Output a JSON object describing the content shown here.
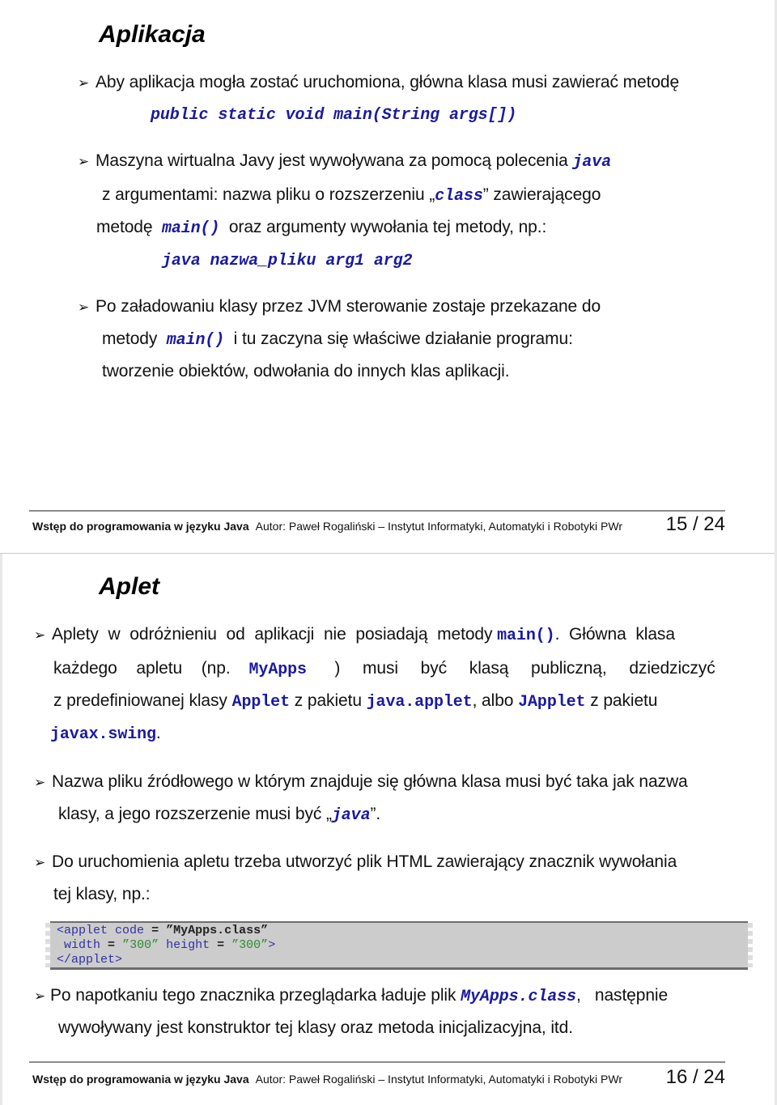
{
  "slides": [
    {
      "title": "Aplikacja",
      "bullets": [
        {
          "lines": [
            {
              "text": "Aby aplikacja mogła zostać uruchomiona, główna klasa musi zawierać metodę"
            },
            {
              "code": "public static void main(String args[])"
            }
          ]
        },
        {
          "line1_text": "Maszyna wirtualna Javy jest wywoływana za pomocą polecenia",
          "line1_code": "java",
          "line2_pre": "z argumentami: nazwa pliku o rozszerzeniu „",
          "line2_code": "class",
          "line2_post": "” zawierającego",
          "line3_pre": "metodę",
          "line3_code": "main()",
          "line3_post": "oraz argumenty wywołania tej metody, np.:",
          "example_code": "java nazwa_pliku arg1 arg2"
        },
        {
          "line1": "Po załadowaniu klasy przez JVM sterowanie zostaje przekazane do",
          "line2_pre": "metody",
          "line2_code": "main()",
          "line2_post": "i tu zaczyna się właściwe działanie programu:",
          "line3": "tworzenie obiektów, odwołania do innych klas aplikacji."
        }
      ],
      "footer": {
        "course": "Wstęp do programowania w języku Java",
        "author": "Autor: Paweł Rogaliński – Instytut Informatyki, Automatyki i Robotyki PWr",
        "page": "15 / 24"
      }
    },
    {
      "title": "Aplet",
      "bullets": [
        {
          "l1_pre": "Aplety w odróżnieniu od aplikacji nie posiadają metody",
          "l1_code": "main()",
          "l1_post": ". Główna klasa",
          "l2_pre": "każdego apletu (np.",
          "l2_code": "MyApps",
          "l2_post": ") musi być klasą publiczną, dziedziczyć",
          "l3_a": "z predefiniowanej klasy",
          "l3_code1": "Applet",
          "l3_b": "z pakietu",
          "l3_code2": "java.applet",
          "l3_c": ", albo",
          "l3_code3": "JApplet",
          "l3_d": "z pakietu",
          "l4_code": "javax.swing",
          "l4_post": "."
        },
        {
          "line1": "Nazwa pliku źródłowego w którym znajduje się główna klasa musi być taka jak nazwa",
          "line2_pre": "klasy, a jego rozszerzenie musi być „",
          "line2_code": "java",
          "line2_post": "”."
        },
        {
          "line1": "Do uruchomienia apletu trzeba utworzyć plik HTML zawierający znacznik wywołania",
          "line2": "tej klasy, np.:"
        },
        {
          "line1_pre": "Po napotkaniu tego znacznika przeglądarka ładuje plik",
          "line1_code": "MyApps.class",
          "line1_post": ",   następnie",
          "line2": "wywoływany jest konstruktor tej klasy oraz metoda inicjalizacyjna, itd."
        }
      ],
      "code_example": {
        "open_tag": "<applet",
        "code_attr": "code",
        "eq": "=",
        "code_val": "”MyApps.class”",
        "width_attr": "width",
        "width_val": "”300”",
        "height_attr": "height",
        "height_val": "”300”",
        "tag_end": ">",
        "close_tag": "</applet>"
      },
      "footer": {
        "course": "Wstęp do programowania w języku Java",
        "author": "Autor: Paweł Rogaliński – Instytut Informatyki, Automatyki i Robotyki PWr",
        "page": "16 / 24"
      }
    }
  ],
  "bullet_glyph": "➢",
  "colors": {
    "code": "#1a1aa0",
    "code_string": "#2e8b2e",
    "code_bg": "#cccccc"
  }
}
